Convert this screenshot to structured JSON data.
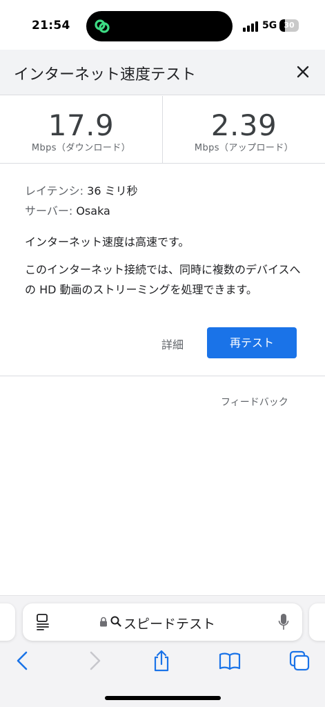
{
  "status_bar": {
    "time": "21:54",
    "network": "5G",
    "battery_level": "30",
    "battery_fraction": 0.3
  },
  "panel": {
    "title": "インターネット速度テスト"
  },
  "results": {
    "download_value": "17.9",
    "download_unit": "Mbps（ダウンロード）",
    "upload_value": "2.39",
    "upload_unit": "Mbps（アップロード）",
    "latency_label": "レイテンシ:",
    "latency_value": "36 ミリ秒",
    "server_label": "サーバー:",
    "server_value": "Osaka",
    "summary": "インターネット速度は高速です。",
    "description": "このインターネット接続では、同時に複数のデバイスへの HD 動画のストリーミングを処理できます。"
  },
  "actions": {
    "details": "詳細",
    "retest": "再テスト",
    "feedback": "フィードバック"
  },
  "browser": {
    "address_text": "スピードテスト"
  },
  "colors": {
    "accent": "#1a73e8",
    "island_icon": "#3ddc84"
  }
}
